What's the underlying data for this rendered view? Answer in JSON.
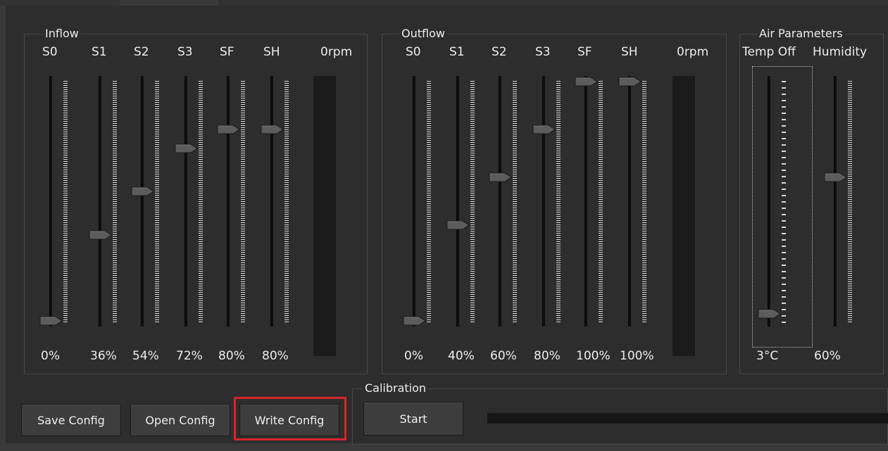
{
  "inflow": {
    "title": "Inflow",
    "rpm": "0rpm",
    "sliders": [
      {
        "label": "S0",
        "value": "0%",
        "level": 0.0
      },
      {
        "label": "S1",
        "value": "36%",
        "level": 0.36
      },
      {
        "label": "S2",
        "value": "54%",
        "level": 0.54
      },
      {
        "label": "S3",
        "value": "72%",
        "level": 0.72
      },
      {
        "label": "SF",
        "value": "80%",
        "level": 0.8
      },
      {
        "label": "SH",
        "value": "80%",
        "level": 0.8
      }
    ]
  },
  "outflow": {
    "title": "Outflow",
    "rpm": "0rpm",
    "sliders": [
      {
        "label": "S0",
        "value": "0%",
        "level": 0.0
      },
      {
        "label": "S1",
        "value": "40%",
        "level": 0.4
      },
      {
        "label": "S2",
        "value": "60%",
        "level": 0.6
      },
      {
        "label": "S3",
        "value": "80%",
        "level": 0.8
      },
      {
        "label": "SF",
        "value": "100%",
        "level": 1.0
      },
      {
        "label": "SH",
        "value": "100%",
        "level": 1.0
      }
    ]
  },
  "air": {
    "title": "Air Parameters",
    "temp": {
      "label": "Temp Off",
      "value": "3°C",
      "level": 0.03
    },
    "humidity": {
      "label": "Humidity",
      "value": "60%",
      "level": 0.6
    }
  },
  "calibration": {
    "title": "Calibration",
    "start_label": "Start",
    "progress": 0
  },
  "toolbar": {
    "save_label": "Save Config",
    "open_label": "Open Config",
    "write_label": "Write Config"
  },
  "colors": {
    "highlight": "#d8242c",
    "background": "#2d2d2d",
    "meter": "#1b1b1b"
  }
}
